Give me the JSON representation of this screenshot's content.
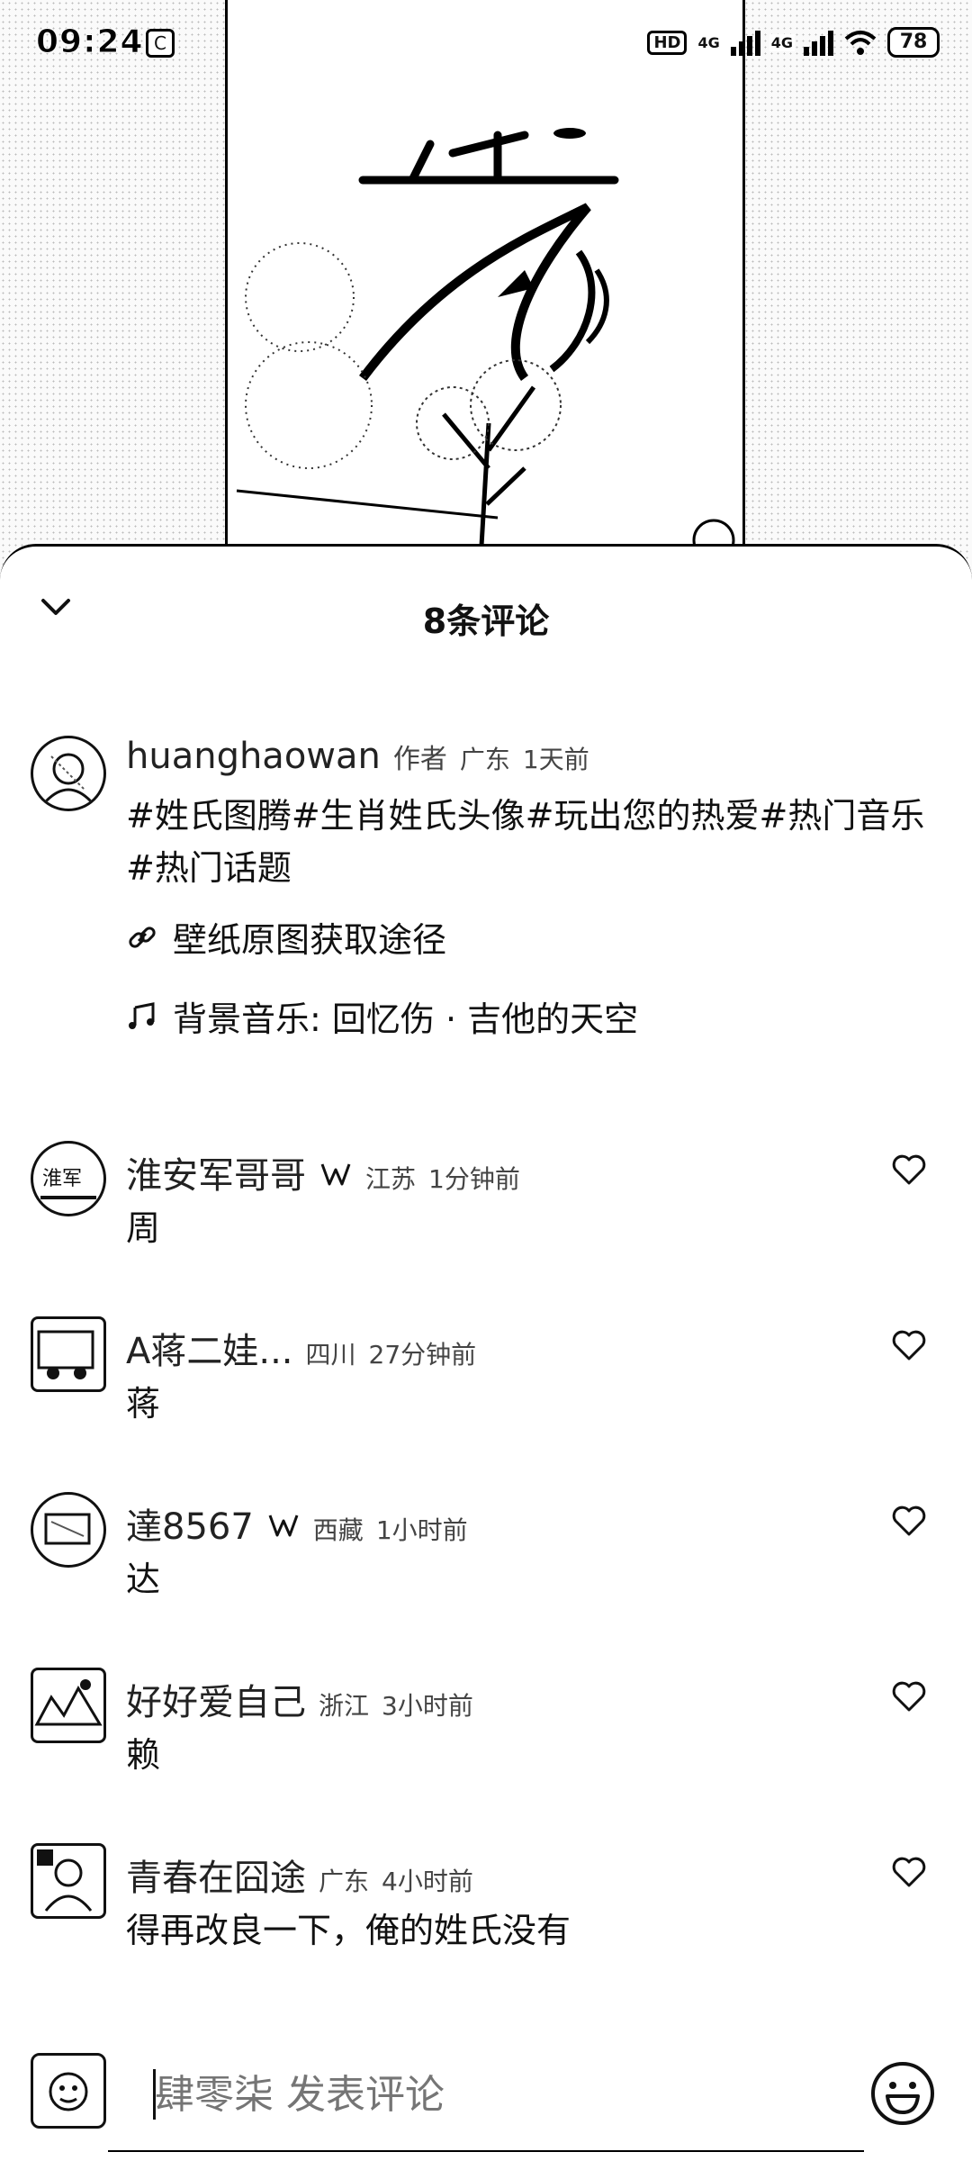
{
  "status_bar": {
    "time": "09:24",
    "hd": "HD",
    "network_1": "4G",
    "network_2": "4G",
    "battery": "78"
  },
  "sheet": {
    "title": "8条评论"
  },
  "author_post": {
    "username": "huanghaowan",
    "author_tag": "作者",
    "location": "广东",
    "time": "1天前",
    "text": "#姓氏图腾#生肖姓氏头像#玩出您的热爱#热门音乐#热门话题",
    "link_label": "壁纸原图获取途径",
    "music_label": "背景音乐: 回忆伤 · 吉他的天空"
  },
  "comments": [
    {
      "username": "淮安军哥哥",
      "vip": true,
      "location": "江苏",
      "time": "1分钟前",
      "text": "周"
    },
    {
      "username": "A蒋二娃...",
      "vip": false,
      "location": "四川",
      "time": "27分钟前",
      "text": "蒋"
    },
    {
      "username": "達8567",
      "vip": true,
      "location": "西藏",
      "time": "1小时前",
      "text": "达"
    },
    {
      "username": "好好爱自己",
      "vip": false,
      "location": "浙江",
      "time": "3小时前",
      "text": "赖"
    },
    {
      "username": "青春在囧途",
      "vip": false,
      "location": "广东",
      "time": "4小时前",
      "text": "得再改良一下，俺的姓氏没有"
    }
  ],
  "input": {
    "placeholder": "肆零柒 发表评论"
  },
  "icons": {
    "collapse": "chevron-down-icon",
    "link": "link-icon",
    "music": "music-note-icon",
    "like": "heart-icon",
    "vip": "vip-badge-icon",
    "emoji": "emoji-icon"
  }
}
